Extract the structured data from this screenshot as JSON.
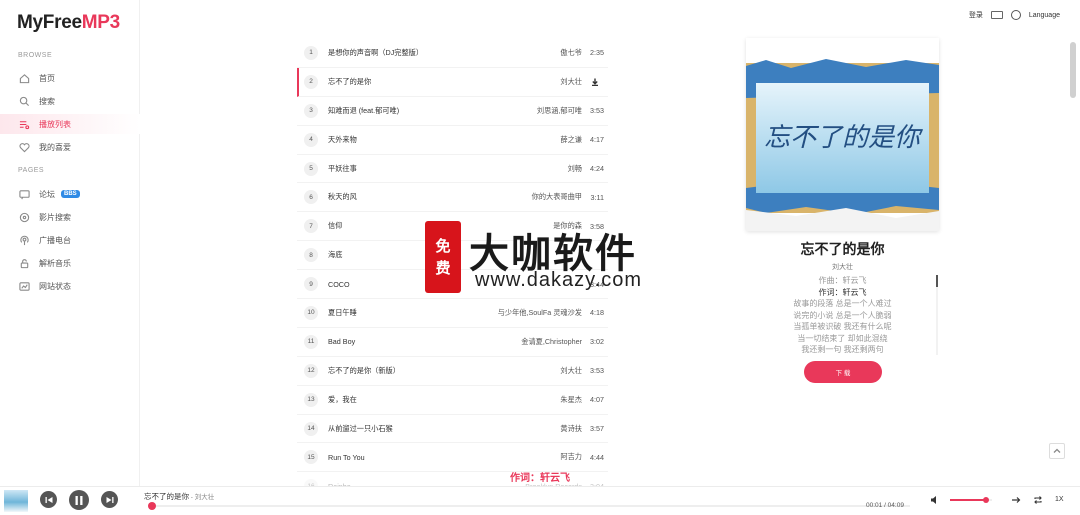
{
  "app": {
    "logo_main": "MyFree",
    "logo_accent": "MP3"
  },
  "sidebar": {
    "browse_title": "BROWSE",
    "pages_title": "PAGES",
    "browse_items": [
      {
        "label": "首页",
        "icon": "home-icon"
      },
      {
        "label": "搜索",
        "icon": "search-icon"
      },
      {
        "label": "播放列表",
        "icon": "playlist-icon",
        "active": true
      },
      {
        "label": "我的喜爱",
        "icon": "heart-icon"
      }
    ],
    "page_items": [
      {
        "label": "论坛",
        "icon": "forum-icon",
        "badge": "BBS"
      },
      {
        "label": "影片搜索",
        "icon": "film-icon"
      },
      {
        "label": "广播电台",
        "icon": "radio-icon"
      },
      {
        "label": "解析音乐",
        "icon": "lock-icon"
      },
      {
        "label": "网站状态",
        "icon": "status-icon"
      }
    ]
  },
  "topbar": {
    "login": "登录",
    "language": "Language"
  },
  "songs": [
    {
      "num": "1",
      "title": "是想你的声音啊（DJ完整版）",
      "artist": "傲七爷",
      "duration": "2:35"
    },
    {
      "num": "2",
      "title": "忘不了的是你",
      "artist": "刘大壮",
      "duration": "",
      "active": true
    },
    {
      "num": "3",
      "title": "知难而退 (feat.郁可唯)",
      "artist": "刘思涵,郁可唯",
      "duration": "3:53"
    },
    {
      "num": "4",
      "title": "天外来物",
      "artist": "薛之谦",
      "duration": "4:17"
    },
    {
      "num": "5",
      "title": "平妖往事",
      "artist": "刘畅",
      "duration": "4:24"
    },
    {
      "num": "6",
      "title": "秋天的风",
      "artist": "你的大表哥曲甲",
      "duration": "3:11"
    },
    {
      "num": "7",
      "title": "信仰",
      "artist": "是你的森",
      "duration": "3:58"
    },
    {
      "num": "8",
      "title": "海底",
      "artist": "",
      "duration": ""
    },
    {
      "num": "9",
      "title": "COCO",
      "artist": "",
      "duration": "3:44"
    },
    {
      "num": "10",
      "title": "夏日午睡",
      "artist": "与少年他,SoulFa 灵魂沙发",
      "duration": "4:18"
    },
    {
      "num": "11",
      "title": "Bad Boy",
      "artist": "金请夏,Christopher",
      "duration": "3:02"
    },
    {
      "num": "12",
      "title": "忘不了的是你（新版）",
      "artist": "刘大壮",
      "duration": "3:53"
    },
    {
      "num": "13",
      "title": "爱，我在",
      "artist": "朱星杰",
      "duration": "4:07"
    },
    {
      "num": "14",
      "title": "从前遛过一只小石猴",
      "artist": "黄诗扶",
      "duration": "3:57"
    },
    {
      "num": "15",
      "title": "Run To You",
      "artist": "阿吉力",
      "duration": "4:44"
    },
    {
      "num": "16",
      "title": "Rainbo",
      "artist": "Brooklyn Records",
      "duration": "3:04",
      "faded": true
    }
  ],
  "now_playing": {
    "title": "忘不了的是你",
    "artist": "刘大壮",
    "cover_text": "忘不了的是你",
    "lyrics": [
      {
        "text": "作曲：轩云飞",
        "current": false
      },
      {
        "text": "作词：轩云飞",
        "current": true
      },
      {
        "text": "故事的段落 总是一个人难过",
        "current": false
      },
      {
        "text": "说完的小说 总是一个人脆弱",
        "current": false
      },
      {
        "text": "当孤单被识破 我还有什么呢",
        "current": false
      },
      {
        "text": "当一切结束了 却如此混绕",
        "current": false
      },
      {
        "text": "我还剩一句 我还剩两句",
        "current": false
      }
    ],
    "download_label": "下 载",
    "lyric_overlay": "作词：轩云飞"
  },
  "watermark": {
    "seal": [
      "免",
      "费"
    ],
    "big_text": "大咖软件",
    "url": "www.dakazy.com"
  },
  "player": {
    "title": "忘不了的是你",
    "separator": " - ",
    "artist": "刘大壮",
    "time": "00:01 / 04:09",
    "progress_fraction": 0.004,
    "volume_fraction": 0.85,
    "speed": "1X"
  },
  "colors": {
    "accent": "#e9385a",
    "badge": "#2f8ae5",
    "watermark_seal": "#d7141b"
  }
}
